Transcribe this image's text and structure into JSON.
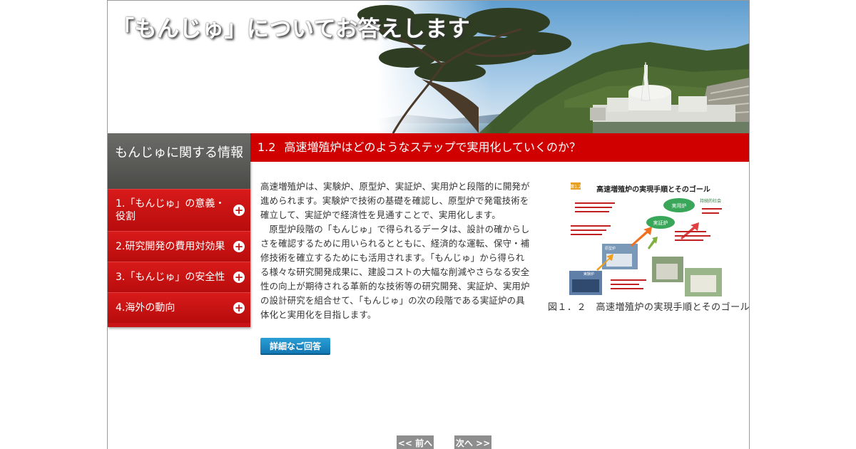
{
  "banner": {
    "title": "「もんじゅ」についてお答えします"
  },
  "sidebar": {
    "heading": "もんじゅに関する情報",
    "items": [
      {
        "label": "1.「もんじゅ」の意義・役割"
      },
      {
        "label": "2.研究開発の費用対効果"
      },
      {
        "label": "3.「もんじゅ」の安全性"
      },
      {
        "label": "4.海外の動向"
      }
    ]
  },
  "section": {
    "number": "1.2",
    "title": "高速増殖炉はどのようなステップで実用化していくのか？"
  },
  "body": {
    "paragraph1": "高速増殖炉は、実験炉、原型炉、実証炉、実用炉と段階的に開発が進められます。実験炉で技術の基礎を確認し、原型炉で発電技術を確立して、実証炉で経済性を見通すことで、実用化します。",
    "paragraph2": "原型炉段階の「もんじゅ」で得られるデータは、設計の確からしさを確認するために用いられるとともに、経済的な運転、保守・補修技術を確立するためにも活用されます。「もんじゅ」から得られる様々な研究開発成果に、建設コストの大幅な削減やさらなる安全性の向上が期待される革新的な技術等の研究開発、実証炉、実用炉の設計研究を組合せて、「もんじゅ」の次の段階である実証炉の具体化と実用化を目指します。"
  },
  "detail_button": {
    "label": "詳細なご回答"
  },
  "figure": {
    "title": "高速増殖炉の実現手順とそのゴール",
    "tag": "第1.2",
    "caption": "図１．２　高速増殖炉の実現手順とそのゴール",
    "stages": [
      "実験炉",
      "原型炉",
      "実証炉",
      "実用炉",
      "持続的社会"
    ]
  },
  "pagination": {
    "prev_label": "<< 前へ",
    "next_label": "次へ >>"
  },
  "colors": {
    "accent_red": "#d00000",
    "sidebar_head": "#5a5a57",
    "button_blue": "#1a87c4",
    "nav_gray": "#8e8e8e"
  }
}
